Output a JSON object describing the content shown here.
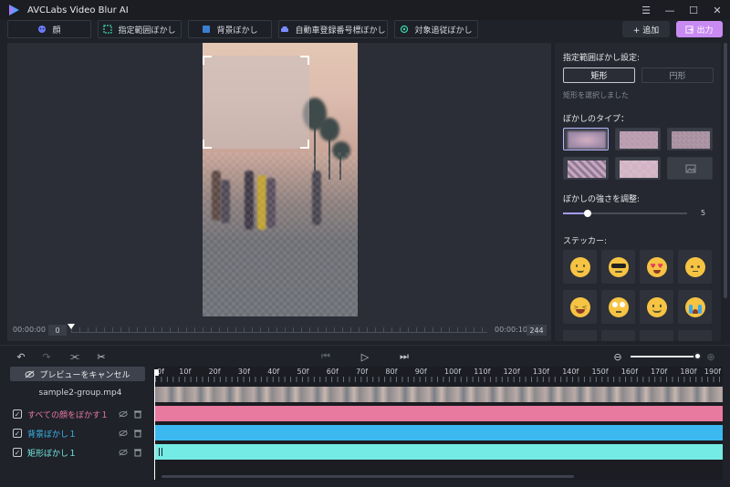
{
  "app": {
    "title": "AVCLabs Video Blur AI"
  },
  "modes": [
    {
      "label": "顔",
      "icon": "face-icon"
    },
    {
      "label": "指定範囲ぼかし",
      "icon": "area-icon"
    },
    {
      "label": "背景ぼかし",
      "icon": "background-icon"
    },
    {
      "label": "自動車登録番号標ぼかし",
      "icon": "car-icon"
    },
    {
      "label": "対象追従ぼかし",
      "icon": "tracking-icon"
    }
  ],
  "header": {
    "add_label": "+ 追加",
    "export_label": "出力"
  },
  "preview": {
    "time_start": "00:00:00",
    "frame_start": "0",
    "time_end": "00:00:10",
    "frame_end": "244"
  },
  "settings": {
    "area_title": "指定範囲ぼかし設定:",
    "shape_rect": "矩形",
    "shape_circle": "円形",
    "shape_hint": "矩形を選択しました",
    "blur_type_title": "ぼかしのタイプ：",
    "strength_title": "ぼかしの強さを調整:",
    "strength_value": "5",
    "strength_fraction": 0.2,
    "sticker_title": "ステッカー:"
  },
  "timeline": {
    "cancel_preview": "プレビューをキャンセル",
    "filename": "sample2-group.mp4",
    "tracks": [
      {
        "name": "すべての顔をぼかす１",
        "color": "#e8799f"
      },
      {
        "name": "背景ぼかし１",
        "color": "#3bb8f0"
      },
      {
        "name": "矩形ぼかし１",
        "color": "#74ebe4"
      }
    ],
    "ruler": [
      "0f",
      "10f",
      "20f",
      "30f",
      "40f",
      "50f",
      "60f",
      "70f",
      "80f",
      "90f",
      "100f",
      "110f",
      "120f",
      "130f",
      "140f",
      "150f",
      "160f",
      "170f",
      "180f",
      "190f"
    ]
  },
  "colors": {
    "accent": "#a79cff",
    "export": "#c98bf2"
  }
}
